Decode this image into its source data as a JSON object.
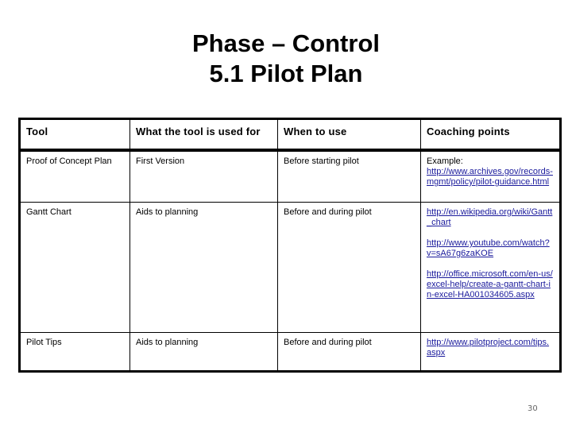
{
  "title": {
    "line1": "Phase – Control",
    "line2": "5.1 Pilot Plan"
  },
  "table": {
    "headers": [
      "Tool",
      "What the tool is used for",
      "When to use",
      "Coaching points"
    ],
    "rows": [
      {
        "tool": "Proof of Concept Plan",
        "used_for": "First Version",
        "when": "Before starting pilot",
        "coaching_prefix": "Example:",
        "links": [
          "http://www.archives.gov/records-mgmt/policy/pilot-guidance.html"
        ]
      },
      {
        "tool": "Gantt Chart",
        "used_for": "Aids to planning",
        "when": "Before and during pilot",
        "links": [
          "http://en.wikipedia.org/wiki/Gantt_chart",
          "http://www.youtube.com/watch?v=sA67g6zaKOE",
          "http://office.microsoft.com/en-us/excel-help/create-a-gantt-chart-in-excel-HA001034605.aspx"
        ]
      },
      {
        "tool": "Pilot Tips",
        "used_for": "Aids to planning",
        "when": "Before and during pilot",
        "links": [
          "http://www.pilotproject.com/tips.aspx"
        ]
      }
    ]
  },
  "page_number": "30",
  "colors": {
    "link": "#1a1a9c",
    "border": "#000000",
    "page_number": "#666666"
  }
}
